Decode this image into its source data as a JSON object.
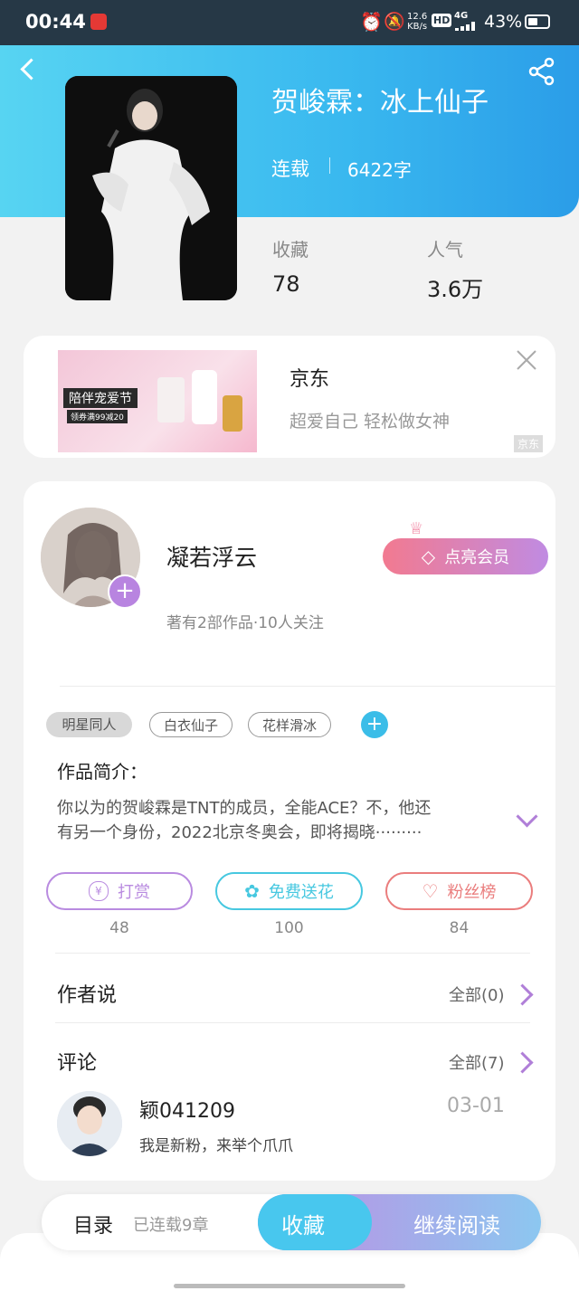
{
  "status": {
    "time": "00:44",
    "speed_top": "12.6",
    "speed_bottom": "KB/s",
    "hd": "HD",
    "net": "4G",
    "battery": "43%"
  },
  "book": {
    "title": "贺峻霖：冰上仙子",
    "status": "连载",
    "words": "6422字"
  },
  "stats": {
    "fav_label": "收藏",
    "fav_value": "78",
    "pop_label": "人气",
    "pop_value": "3.6万"
  },
  "ad": {
    "name": "京东",
    "slogan": "超爱自己 轻松做女神",
    "source": "京东",
    "banner_title": "陪伴宠爱节",
    "banner_sub": "领券满99减20"
  },
  "author": {
    "name": "凝若浮云",
    "meta": "著有2部作品·10人关注",
    "vip_label": "点亮会员"
  },
  "tags": [
    "明星同人",
    "白衣仙子",
    "花样滑冰"
  ],
  "intro": {
    "label": "作品简介：",
    "line1": "你以为的贺峻霖是TNT的成员，全能ACE？不，他还",
    "line2": "有另一个身份，2022北京冬奥会，即将揭晓·········"
  },
  "actions": [
    {
      "label": "打赏",
      "count": "48",
      "color": "#b98be0"
    },
    {
      "label": "免费送花",
      "count": "100",
      "color": "#47c8e0"
    },
    {
      "label": "粉丝榜",
      "count": "84",
      "color": "#ea7d7d"
    }
  ],
  "author_says": {
    "label": "作者说",
    "all": "全部(0)"
  },
  "comments": {
    "label": "评论",
    "all": "全部(7)",
    "user": "颖041209",
    "date": "03-01",
    "text": "我是新粉，来举个爪爪"
  },
  "bottom": {
    "toc": "目录",
    "chapters": "已连载9章",
    "fav": "收藏",
    "read": "继续阅读"
  }
}
